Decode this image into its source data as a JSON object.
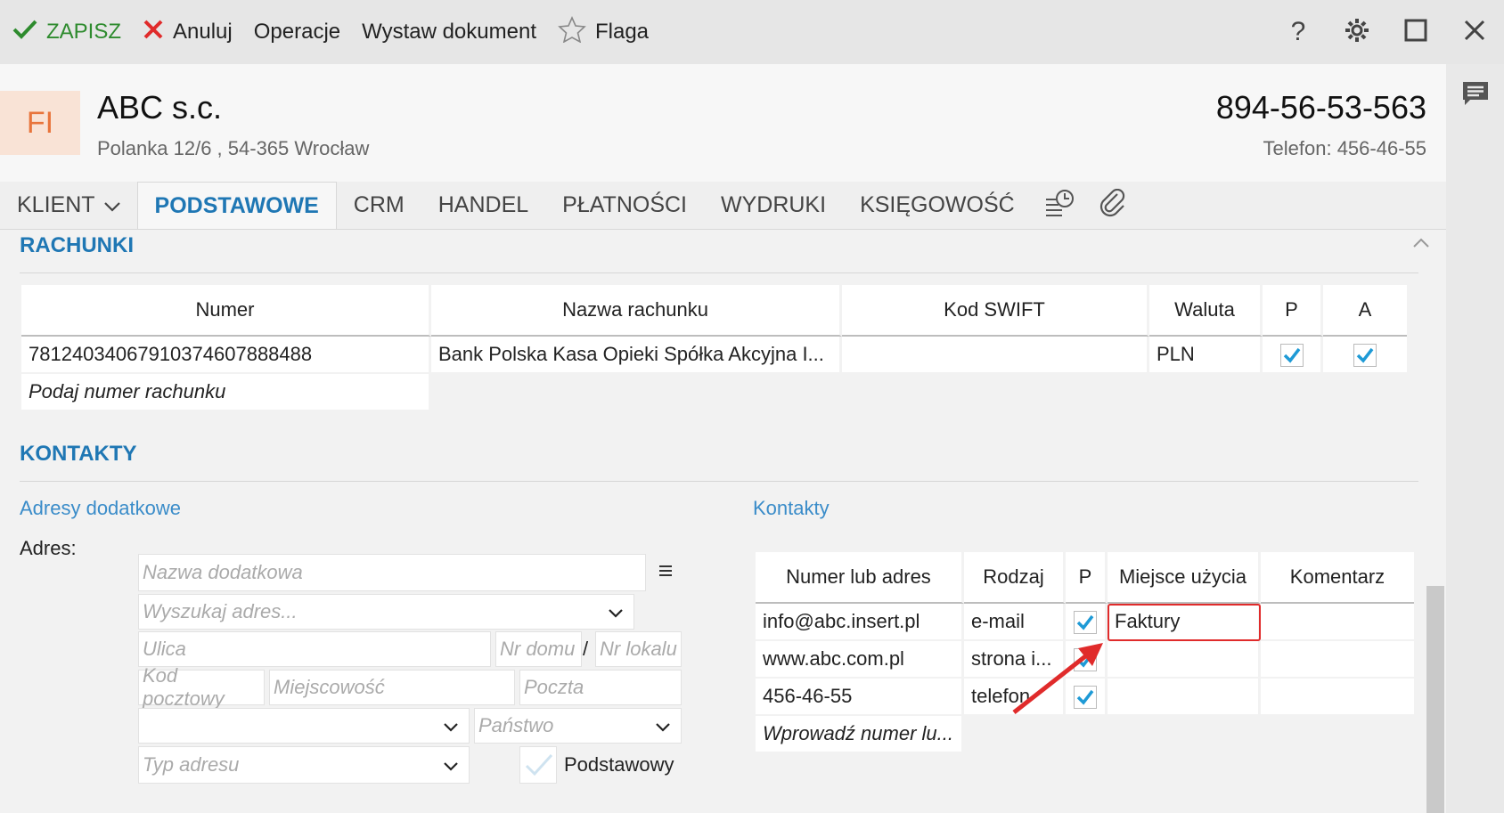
{
  "toolbar": {
    "save_label": "ZAPISZ",
    "cancel_label": "Anuluj",
    "operations_label": "Operacje",
    "issue_document_label": "Wystaw dokument",
    "flag_label": "Flaga",
    "help_label": "?",
    "colors": {
      "save": "#2e8b2e",
      "cancel": "#e02b2b"
    }
  },
  "header": {
    "badge": "FI",
    "company_name": "ABC s.c.",
    "address": "Polanka  12/6 , 54-365 Wrocław",
    "nip": "894-56-53-563",
    "phone": "Telefon: 456-46-55"
  },
  "tabs": [
    {
      "label": "KLIENT"
    },
    {
      "label": "PODSTAWOWE",
      "active": true
    },
    {
      "label": "CRM"
    },
    {
      "label": "HANDEL"
    },
    {
      "label": "PŁATNOŚCI"
    },
    {
      "label": "WYDRUKI"
    },
    {
      "label": "KSIĘGOWOŚĆ"
    }
  ],
  "accounts": {
    "title": "RACHUNKI",
    "headers": [
      "Numer",
      "Nazwa rachunku",
      "Kod SWIFT",
      "Waluta",
      "P",
      "A"
    ],
    "rows": [
      {
        "number": "78124034067910374607888488",
        "name": "Bank Polska Kasa Opieki Spółka Akcyjna I...",
        "swift": "",
        "currency": "PLN",
        "p": true,
        "a": true
      }
    ],
    "new_placeholder": "Podaj numer rachunku"
  },
  "contacts": {
    "title": "KONTAKTY",
    "addresses": {
      "title": "Adresy dodatkowe",
      "address_label": "Adres:",
      "name_placeholder": "Nazwa dodatkowa",
      "search_placeholder": "Wyszukaj adres...",
      "street_placeholder": "Ulica",
      "house_placeholder": "Nr domu",
      "separator": "/",
      "flat_placeholder": "Nr lokalu",
      "postal_placeholder": "Kod pocztowy",
      "city_placeholder": "Miejscowość",
      "post_placeholder": "Poczta",
      "country_placeholder": "Państwo",
      "type_placeholder": "Typ adresu",
      "default_label": "Podstawowy"
    },
    "list": {
      "title": "Kontakty",
      "headers": [
        "Numer lub adres",
        "Rodzaj",
        "P",
        "Miejsce użycia",
        "Komentarz"
      ],
      "rows": [
        {
          "value": "info@abc.insert.pl",
          "kind": "e-mail",
          "p": true,
          "usage": "Faktury",
          "comment": ""
        },
        {
          "value": "www.abc.com.pl",
          "kind": "strona i...",
          "p": true,
          "usage": "",
          "comment": ""
        },
        {
          "value": "456-46-55",
          "kind": "telefon",
          "p": true,
          "usage": "",
          "comment": ""
        }
      ],
      "new_placeholder": "Wprowadź numer lu..."
    }
  },
  "annotation": {
    "highlight_color": "#e02b2b"
  }
}
